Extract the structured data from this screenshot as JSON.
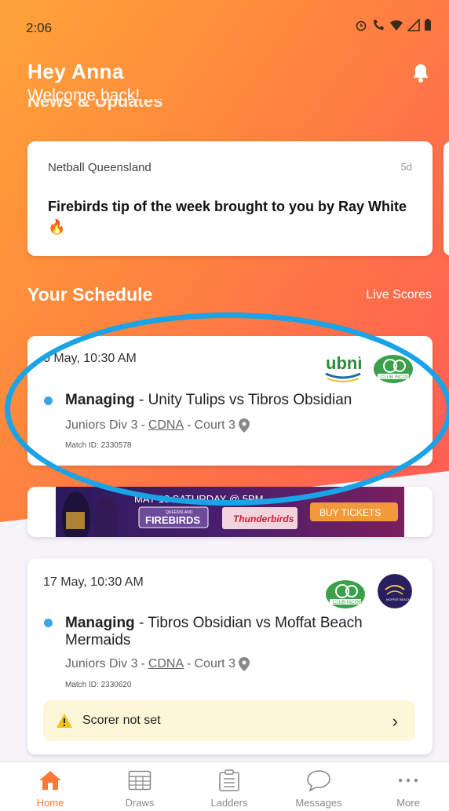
{
  "status_bar": {
    "time": "2:06"
  },
  "header": {
    "greeting": "Hey Anna",
    "subtitle": "Welcome back!",
    "ghost_text": "News & Updates"
  },
  "news": {
    "source": "Netball Queensland",
    "age": "5d",
    "title": "Firebirds tip of the week brought to you by Ray White🔥"
  },
  "schedule": {
    "title": "Your Schedule",
    "live_scores_label": "Live Scores",
    "matches": [
      {
        "date": "0 May, 10:30 AM",
        "role": "Managing",
        "separator": " - ",
        "teams": "Unity Tulips vs Tibros Obsidian",
        "division": "Juniors Div 3",
        "association": "CDNA",
        "court": "Court 3",
        "match_id": "Match ID: 2330578",
        "logos": [
          "ubni-logo",
          "club-incog-logo"
        ]
      },
      {
        "date": "17 May, 10:30 AM",
        "role": "Managing",
        "separator": " - ",
        "teams": "Tibros Obsidian vs Moffat Beach Mermaids",
        "division": "Juniors Div 3",
        "association": "CDNA",
        "court": "Court 3",
        "match_id": "Match ID: 2330620",
        "logos": [
          "club-incog-logo",
          "moffat-beach-logo"
        ],
        "scorer_notice": "Scorer not set"
      }
    ]
  },
  "banner": {
    "date_text": "MAY 18 SATURDAY @ 5PM",
    "brand": "FIREBIRDS",
    "opponent": "Thunderbirds",
    "cta": "BUY TICKETS",
    "badge": "QUEENSLAND"
  },
  "tabs": [
    {
      "label": "Home",
      "icon": "home-icon",
      "active": true
    },
    {
      "label": "Draws",
      "icon": "draws-icon"
    },
    {
      "label": "Ladders",
      "icon": "ladders-icon"
    },
    {
      "label": "Messages",
      "icon": "messages-icon"
    },
    {
      "label": "More",
      "icon": "more-icon"
    }
  ],
  "colors": {
    "accent": "#ff7a3a",
    "highlight_ring": "#1aa3e6",
    "status_dot": "#3aa6e8",
    "notice_bg": "#fdf7d8"
  }
}
